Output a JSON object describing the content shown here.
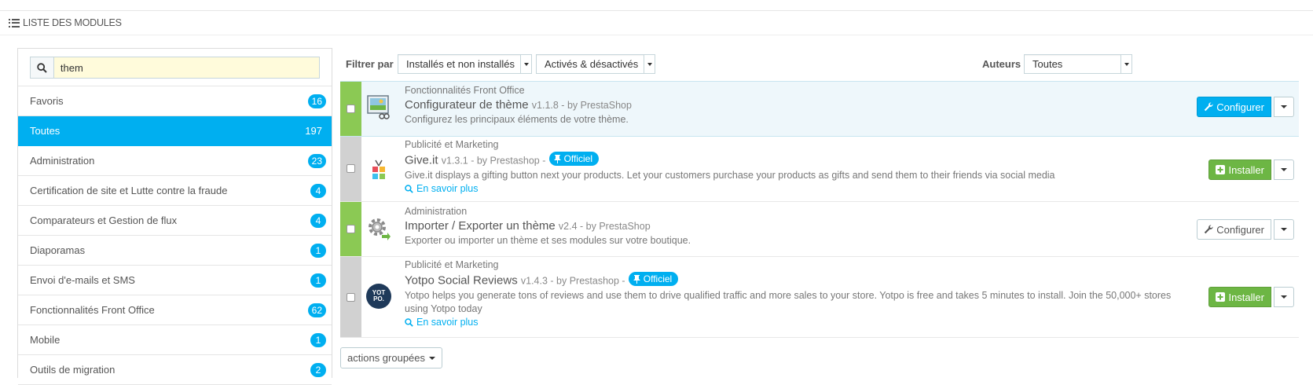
{
  "panel": {
    "title": "Liste des modules"
  },
  "search": {
    "value": "them",
    "placeholder": ""
  },
  "categories": [
    {
      "label": "Favoris",
      "count": "16",
      "active": false
    },
    {
      "label": "Toutes",
      "count": "197",
      "active": true
    },
    {
      "label": "Administration",
      "count": "23",
      "active": false
    },
    {
      "label": "Certification de site et Lutte contre la fraude",
      "count": "4",
      "active": false
    },
    {
      "label": "Comparateurs et Gestion de flux",
      "count": "4",
      "active": false
    },
    {
      "label": "Diaporamas",
      "count": "1",
      "active": false
    },
    {
      "label": "Envoi d'e-mails et SMS",
      "count": "1",
      "active": false
    },
    {
      "label": "Fonctionnalités Front Office",
      "count": "62",
      "active": false
    },
    {
      "label": "Mobile",
      "count": "1",
      "active": false
    },
    {
      "label": "Outils de migration",
      "count": "2",
      "active": false
    }
  ],
  "filters": {
    "label": "Filtrer par",
    "install_select": "Installés et non installés",
    "status_select": "Activés & désactivés",
    "authors_label": "Auteurs",
    "authors_select": "Toutes"
  },
  "modules": [
    {
      "category": "Fonctionnalités Front Office",
      "name": "Configurateur de thème",
      "meta": "v1.1.8 - by PrestaShop",
      "description": "Configurez les principaux éléments de votre thème.",
      "button": "Configurer",
      "icon": "theme-configurator-icon"
    },
    {
      "category": "Publicité et Marketing",
      "name": "Give.it",
      "meta": "v1.3.1 - by Prestashop -",
      "badge": "Officiel",
      "description": "Give.it displays a gifting button next your products. Let your customers purchase your products as gifts and send them to their friends via social media",
      "more": "En savoir plus",
      "button": "Installer",
      "icon": "giveit-icon"
    },
    {
      "category": "Administration",
      "name": "Importer / Exporter un thème",
      "meta": "v2.4 - by PrestaShop",
      "description": "Exporter ou importer un thème et ses modules sur votre boutique.",
      "button": "Configurer",
      "icon": "gear-export-icon"
    },
    {
      "category": "Publicité et Marketing",
      "name": "Yotpo Social Reviews",
      "meta": "v1.4.3 - by Prestashop -",
      "badge": "Officiel",
      "description": "Yotpo helps you generate tons of reviews and use them to drive qualified traffic and more sales to your store. Yotpo is free and takes 5 minutes to install. Join the 50,000+ stores using Yotpo today",
      "more": "En savoir plus",
      "button": "Installer",
      "icon": "yotpo-icon",
      "icon_text": "YOT PO."
    }
  ],
  "bulk_actions": "actions groupées",
  "colors": {
    "accent": "#00aff0",
    "enabled": "#8bc954",
    "disabled": "#d1d1d1",
    "install": "#6db644"
  }
}
